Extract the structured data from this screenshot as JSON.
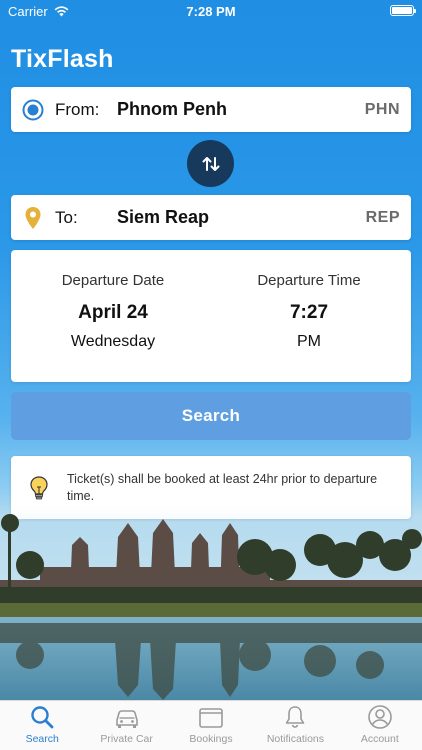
{
  "status_bar": {
    "carrier": "Carrier",
    "time": "7:28 PM"
  },
  "app": {
    "title": "TixFlash"
  },
  "from": {
    "label": "From:",
    "city": "Phnom Penh",
    "code": "PHN",
    "icon": "radio-target-icon"
  },
  "swap": {
    "icon": "swap-arrows-icon"
  },
  "to": {
    "label": "To:",
    "city": "Siem Reap",
    "code": "REP",
    "icon": "map-pin-icon"
  },
  "departure": {
    "date_label": "Departure Date",
    "date": "April 24",
    "weekday": "Wednesday",
    "time_label": "Departure Time",
    "time": "7:27",
    "ampm": "PM"
  },
  "search": {
    "label": "Search"
  },
  "notice": {
    "text": "Ticket(s) shall be booked at least 24hr prior to departure time.",
    "icon": "lightbulb-icon"
  },
  "colors": {
    "primary": "#2a7fd0",
    "accent_dark": "#173a5c",
    "search_button": "#5f9ee0"
  },
  "tabs": [
    {
      "label": "Search",
      "icon": "search-icon",
      "active": true
    },
    {
      "label": "Private Car",
      "icon": "car-icon",
      "active": false
    },
    {
      "label": "Bookings",
      "icon": "bookings-icon",
      "active": false
    },
    {
      "label": "Notifications",
      "icon": "bell-icon",
      "active": false
    },
    {
      "label": "Account",
      "icon": "user-icon",
      "active": false
    }
  ]
}
